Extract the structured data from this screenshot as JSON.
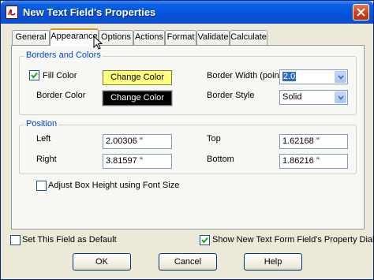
{
  "window": {
    "title": "New Text Field's Properties"
  },
  "tabs": [
    {
      "label": "General",
      "active": false
    },
    {
      "label": "Appearance",
      "active": true
    },
    {
      "label": "Options",
      "active": false
    },
    {
      "label": "Actions",
      "active": false
    },
    {
      "label": "Format",
      "active": false
    },
    {
      "label": "Validate",
      "active": false
    },
    {
      "label": "Calculate",
      "active": false
    }
  ],
  "borders_colors": {
    "group_label": "Borders and Colors",
    "fill_color_label": "Fill Color",
    "fill_color_checked": true,
    "fill_change_button": "Change Color",
    "fill_color_swatch": "#ffff80",
    "border_color_label": "Border Color",
    "border_change_button": "Change Color",
    "border_color_swatch": "#000000",
    "border_width_label": "Border Width (point)",
    "border_width_value": "2.0",
    "border_style_label": "Border Style",
    "border_style_value": "Solid"
  },
  "position": {
    "group_label": "Position",
    "left_label": "Left",
    "left_value": "2.00306 ''",
    "top_label": "Top",
    "top_value": "1.62168 ''",
    "right_label": "Right",
    "right_value": "3.81597 ''",
    "bottom_label": "Bottom",
    "bottom_value": "1.86216 ''"
  },
  "adjust_box": {
    "label": "Adjust Box Height using Font Size",
    "checked": false
  },
  "footer": {
    "set_default_label": "Set This Field as Default",
    "set_default_checked": false,
    "show_dialog_label": "Show New Text Form Field's Property Dialog",
    "show_dialog_checked": true,
    "ok": "OK",
    "cancel": "Cancel",
    "help": "Help"
  },
  "colors": {
    "titlebar": "#0453d8",
    "active_tab_accent": "#e68b2c",
    "group_label": "#0046d5"
  }
}
